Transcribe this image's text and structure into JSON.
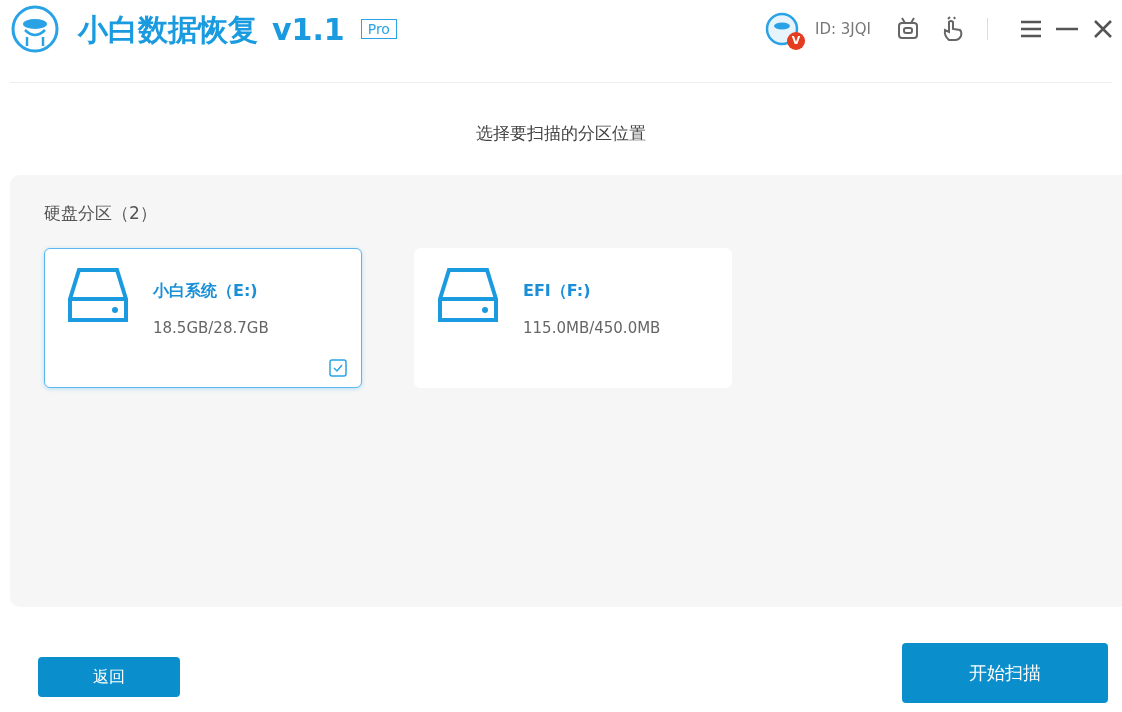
{
  "header": {
    "app_name": "小白数据恢复",
    "version": "v1.1",
    "edition": "Pro",
    "avatar_badge": "V",
    "user_id": "ID: 3JQI"
  },
  "heading": "选择要扫描的分区位置",
  "section": {
    "title": "硬盘分区（2）",
    "partitions": [
      {
        "name": "小白系统（E:)",
        "usage": "18.5GB/28.7GB",
        "selected": true
      },
      {
        "name": "EFI（F:)",
        "usage": "115.0MB/450.0MB",
        "selected": false
      }
    ]
  },
  "buttons": {
    "back": "返回",
    "start": "开始扫描"
  }
}
